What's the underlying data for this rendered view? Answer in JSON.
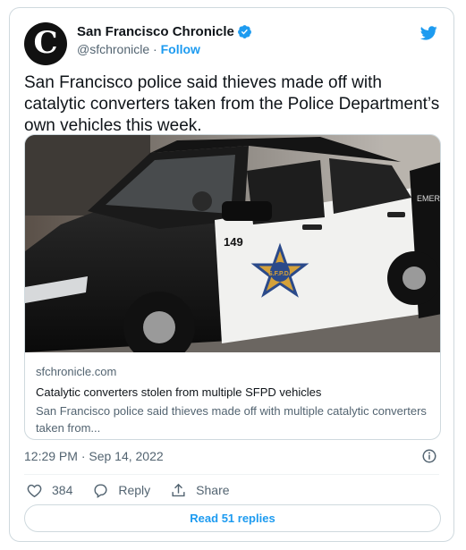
{
  "header": {
    "avatar_letter": "C",
    "display_name": "San Francisco Chronicle",
    "handle": "@sfchronicle",
    "separator": " · ",
    "follow_label": "Follow"
  },
  "tweet": {
    "text": "San Francisco police said thieves made off with catalytic converters taken from the Police Department’s own vehicles this week."
  },
  "card": {
    "image_texts": {
      "car_number": "149",
      "badge": "S.F.P.D.",
      "rear_text": "EMERG"
    },
    "domain": "sfchronicle.com",
    "title": "Catalytic converters stolen from multiple SFPD vehicles",
    "description": "San Francisco police said thieves made off with multiple catalytic converters taken from..."
  },
  "meta": {
    "timestamp": "12:29 PM · Sep 14, 2022"
  },
  "actions": {
    "likes": "384",
    "reply_label": "Reply",
    "share_label": "Share"
  },
  "read_replies_label": "Read 51 replies",
  "icons": {
    "verified": "verified-badge-icon",
    "twitter": "twitter-bird-icon",
    "info": "info-icon",
    "like": "heart-icon",
    "reply": "reply-bubble-icon",
    "share": "share-icon"
  },
  "colors": {
    "accent": "#1d9bf0",
    "text": "#0f1419",
    "muted": "#536471",
    "border": "#cfd9de"
  }
}
